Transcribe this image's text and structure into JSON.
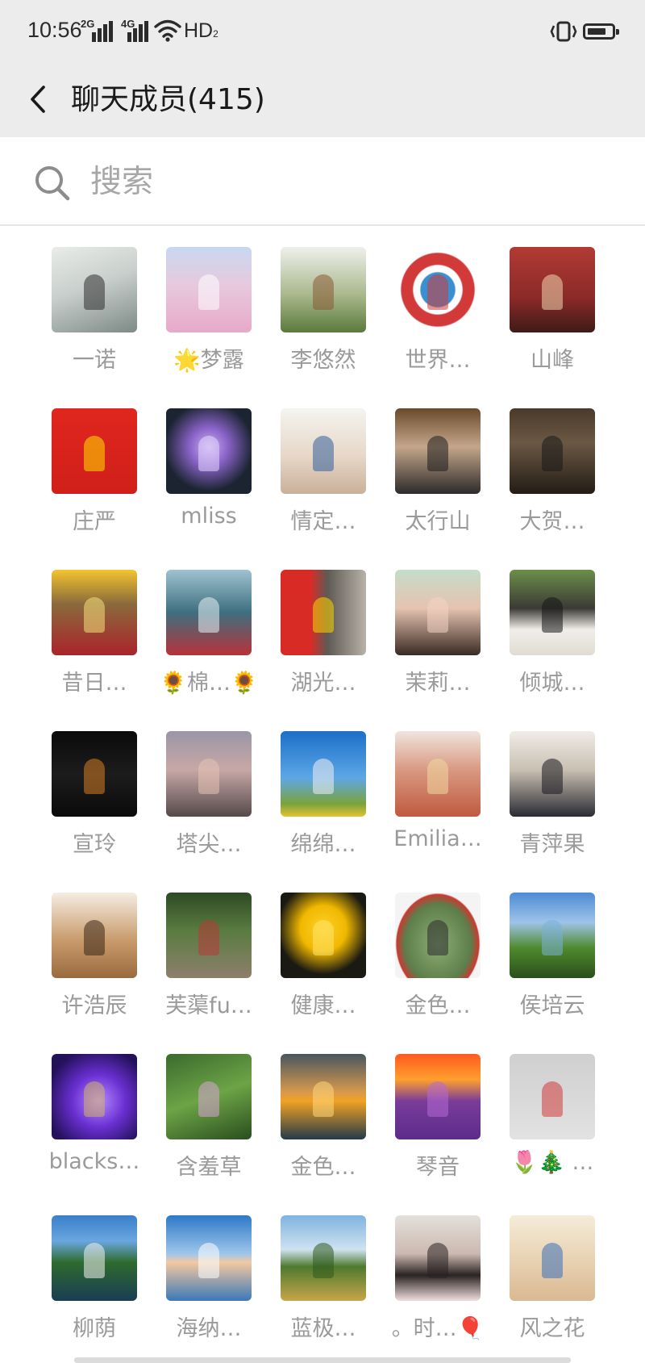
{
  "status": {
    "time": "10:56",
    "net1": "2G",
    "net2": "4G",
    "hd": "HD",
    "hd_sub": "2"
  },
  "header": {
    "title": "聊天成员(415)"
  },
  "search": {
    "placeholder": "搜索"
  },
  "members": [
    {
      "name": "一诺",
      "bg": "linear-gradient(160deg,#e9ece9 0%,#c9cfcc 45%,#7d8a86 100%)",
      "accent": "#2f2f2f"
    },
    {
      "name": "🌟梦露",
      "bg": "linear-gradient(180deg,#c8d8ee 0%,#e7c9de 45%,#e7a9c9 100%)",
      "accent": "#ffffff"
    },
    {
      "name": "李悠然",
      "bg": "linear-gradient(180deg,#eef0ec 0%,#aab98e 55%,#5b7a3c 100%)",
      "accent": "#8a5a34"
    },
    {
      "name": "世界…",
      "bg": "radial-gradient(circle at 50% 50%,#3a8fd0 0%,#3a8fd0 28%,#ffffff 30%,#ffffff 40%,#d23a3a 42%,#d23a3a 60%,#ffffff 62%)",
      "accent": "#d23a3a"
    },
    {
      "name": "山峰",
      "bg": "linear-gradient(180deg,#b23a34 0%,#8a2a27 60%,#3d1b17 100%)",
      "accent": "#f0d7b0"
    },
    {
      "name": "庄严",
      "bg": "linear-gradient(180deg,#e0261f 0%,#d01f19 100%)",
      "accent": "#ffe000"
    },
    {
      "name": "mliss",
      "bg": "radial-gradient(circle at 50% 45%,#c9b0ef 0%,#8a63c8 30%,#1b2430 70%)",
      "accent": "#e6d7ff"
    },
    {
      "name": "情定…",
      "bg": "linear-gradient(180deg,#f4f4ef 0%,#e7d8c9 55%,#c9b09a 100%)",
      "accent": "#335e9a"
    },
    {
      "name": "太行山",
      "bg": "linear-gradient(180deg,#6a4a2c 0%,#c4a68a 45%,#2c2a2a 100%)",
      "accent": "#1e1e1e"
    },
    {
      "name": "大贺…",
      "bg": "linear-gradient(180deg,#4a3a2a 0%,#6b5844 40%,#231c15 100%)",
      "accent": "#191919"
    },
    {
      "name": "昔日…",
      "bg": "linear-gradient(180deg,#f3c52e 0%,#8a6a3c 40%,#a9242a 100%)",
      "accent": "#f6e07a"
    },
    {
      "name": "🌻棉…🌻",
      "bg": "linear-gradient(180deg,#9fc3cf 0%,#3e6f80 50%,#b8323a 100%)",
      "accent": "#e8f2f5"
    },
    {
      "name": "湖光…",
      "bg": "linear-gradient(90deg,#d92b26 0%,#d92b26 35%,#5e5a54 55%,#b8b2a8 100%)",
      "accent": "#ffd600"
    },
    {
      "name": "茉莉…",
      "bg": "linear-gradient(180deg,#c5ddc9 0%,#e5c3b1 45%,#3a2a22 100%)",
      "accent": "#f4d4c2"
    },
    {
      "name": "倾城…",
      "bg": "linear-gradient(180deg,#6d8f4a 0%,#3b3a35 45%,#f1eeea 70%,#e0dcd2 100%)",
      "accent": "#151515"
    },
    {
      "name": "宣玲",
      "bg": "linear-gradient(180deg,#0a0a0a 0%,#1c1c1c 50%,#0a0a0a 100%)",
      "accent": "#d57f22"
    },
    {
      "name": "塔尖…",
      "bg": "linear-gradient(180deg,#9a96a6 0%,#c7a8a6 45%,#55494a 100%)",
      "accent": "#e5c3b6"
    },
    {
      "name": "绵绵…",
      "bg": "linear-gradient(180deg,#1b6fc9 0%,#5ea7e6 55%,#7aa33a 85%,#e3c434 100%)",
      "accent": "#f1f1f1"
    },
    {
      "name": "Emilia…",
      "bg": "linear-gradient(180deg,#efe5de 0%,#d99982 45%,#c05a3f 100%)",
      "accent": "#f0d9a0"
    },
    {
      "name": "青萍果",
      "bg": "linear-gradient(180deg,#f0ece8 0%,#c9c0b2 45%,#2a2b33 100%)",
      "accent": "#18181f"
    },
    {
      "name": "许浩辰",
      "bg": "linear-gradient(180deg,#f5ede3 0%,#c99c6d 55%,#9a6a3f 100%)",
      "accent": "#3b2616"
    },
    {
      "name": "芙蕖fu…",
      "bg": "linear-gradient(180deg,#2d4a24 0%,#5a7c41 45%,#8d7f6c 100%)",
      "accent": "#b83838"
    },
    {
      "name": "健康…",
      "bg": "radial-gradient(circle at 50% 42%,#ffd12a 0%,#f0b800 35%,#1a1a12 70%)",
      "accent": "#ffe46a"
    },
    {
      "name": "金色…",
      "bg": "radial-gradient(ellipse at 50% 60%,#8cae74 0%,#5d7d4a 55%,#c93a32 68%,#f4f4f4 70%)",
      "accent": "#2a2a2a"
    },
    {
      "name": "侯培云",
      "bg": "linear-gradient(180deg,#4e8bd6 0%,#9ec3e8 35%,#4f8a2d 65%,#2a4e1c 100%)",
      "accent": "#7ab0d6"
    },
    {
      "name": "blacks…",
      "bg": "radial-gradient(circle at 55% 55%,#b58cff 0%,#6a2fd1 40%,#231159 80%)",
      "accent": "#d2b36a"
    },
    {
      "name": "含羞草",
      "bg": "linear-gradient(160deg,#3b6a2e 0%,#6ca446 50%,#2a4d1e 100%)",
      "accent": "#d9a4d6"
    },
    {
      "name": "金色…",
      "bg": "linear-gradient(180deg,#49565f 0%,#d89a4c 45%,#f2a222 55%,#233a4a 100%)",
      "accent": "#ffd77b"
    },
    {
      "name": "琴音",
      "bg": "linear-gradient(180deg,#ff5a1f 0%,#ff9f2e 30%,#7a3c9a 55%,#5c2c8a 100%)",
      "accent": "#b56ad6"
    },
    {
      "name": "🌷🎄 …",
      "bg": "linear-gradient(180deg,#cfcfcf 0%,#e2e2e2 100%)",
      "accent": "#d23a3a"
    },
    {
      "name": "柳荫",
      "bg": "linear-gradient(180deg,#3a7fc9 0%,#6aa6df 30%,#2e6b2d 55%,#1a3d54 100%)",
      "accent": "#f2f2f2"
    },
    {
      "name": "海纳…",
      "bg": "linear-gradient(180deg,#2e78c8 0%,#9fc6ea 45%,#f2c9a1 55%,#3b78b8 100%)",
      "accent": "#ffffff"
    },
    {
      "name": "蓝极…",
      "bg": "linear-gradient(180deg,#7fb3e0 0%,#cfe2f0 40%,#4e7a2f 60%,#c7a64a 100%)",
      "accent": "#2f5a1e"
    },
    {
      "name": "。时…🎈",
      "bg": "linear-gradient(180deg,#e4e0dc 0%,#cbb9b0 45%,#2a2322 70%,#f0dede 100%)",
      "accent": "#2a2322"
    },
    {
      "name": "风之花",
      "bg": "linear-gradient(180deg,#f4ecd9 0%,#e9d3b4 50%,#d9b992 100%)",
      "accent": "#3b6fb8"
    }
  ]
}
